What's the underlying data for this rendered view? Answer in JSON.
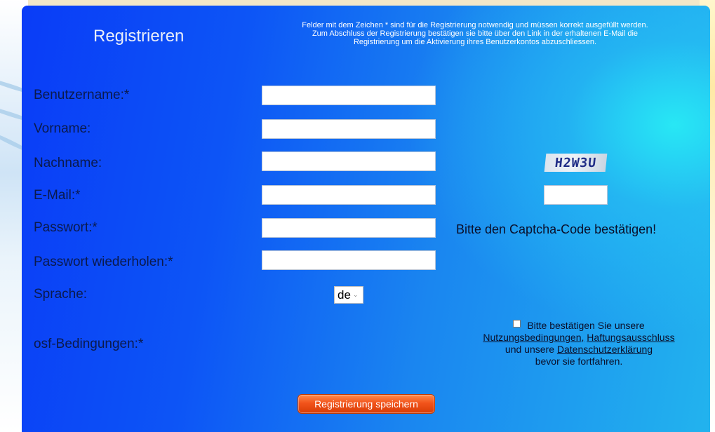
{
  "form": {
    "title": "Registrieren",
    "info_line1": "Felder mit dem Zeichen * sind für die Registrierung notwendig und müssen korrekt ausgefüllt werden.",
    "info_line2": "Zum Abschluss der Registrierung bestätigen sie bitte über den Link in der erhaltenen E-Mail die",
    "info_line3": "Registrierung um die Aktivierung ihres Benutzerkontos abzuschliessen.",
    "fields": [
      {
        "label": "Benutzername:*",
        "value": ""
      },
      {
        "label": "Vorname:",
        "value": ""
      },
      {
        "label": "Nachname:",
        "value": ""
      },
      {
        "label": "E-Mail:*",
        "value": ""
      },
      {
        "label": "Passwort:*",
        "value": ""
      },
      {
        "label": "Passwort wiederholen:*",
        "value": ""
      }
    ],
    "language": {
      "label": "Sprache:",
      "selected": "de"
    },
    "terms": {
      "label": "osf-Bedingungen:*",
      "line1": "Bitte bestätigen Sie unsere",
      "link_terms": "Nutzungsbedingungen,",
      "link_disclaimer": "Haftungsausschluss",
      "and_text": "und unsere",
      "link_privacy": "Datenschutzerklärung",
      "line4": "bevor sie fortfahren."
    },
    "submit_label": "Registrierung speichern"
  },
  "captcha": {
    "code": "H2W3U",
    "value": "",
    "message": "Bitte den Captcha-Code bestätigen!"
  },
  "colors": {
    "panel_start": "#0a3cf7",
    "panel_end": "#22b3ee",
    "button": "#f2541b",
    "label_text": "#0b1a4c"
  }
}
